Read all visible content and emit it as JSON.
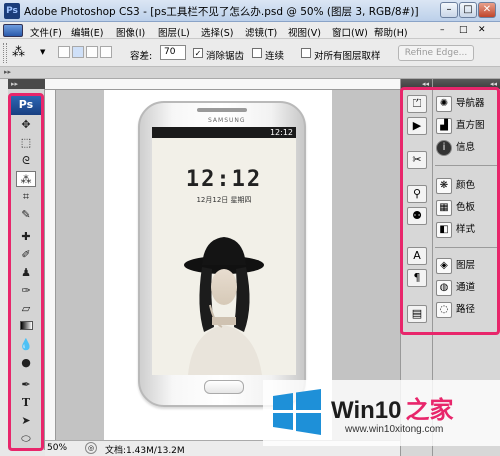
{
  "window": {
    "title": "Adobe Photoshop CS3 - [ps工具栏不见了怎么办.psd @ 50% (图层 3, RGB/8#)]",
    "buttons": [
      "–",
      "□",
      "✕"
    ]
  },
  "menubar": {
    "items": [
      "文件(F)",
      "编辑(E)",
      "图像(I)",
      "图层(L)",
      "选择(S)",
      "滤镜(T)",
      "视图(V)",
      "窗口(W)",
      "帮助(H)"
    ],
    "mdi_buttons": [
      "–",
      "□",
      "✕"
    ]
  },
  "options_bar": {
    "tolerance_label": "容差:",
    "tolerance_value": "70",
    "antialias_label": "消除锯齿",
    "antialias_checked": true,
    "contiguous_label": "连续",
    "contiguous_checked": false,
    "all_layers_label": "对所有图层取样",
    "all_layers_checked": false,
    "refine_edge": "Refine Edge..."
  },
  "toolbox": {
    "logo": "Ps",
    "tools": [
      "move-tool",
      "marquee-tool",
      "lasso-tool",
      "magic-wand-tool",
      "crop-tool",
      "eyedropper-tool",
      "healing-tool",
      "brush-tool",
      "clone-stamp-tool",
      "history-brush-tool",
      "eraser-tool",
      "gradient-tool",
      "blur-tool",
      "dodge-tool",
      "pen-tool",
      "type-tool",
      "path-select-tool",
      "shape-tool"
    ],
    "selected": "magic-wand-tool",
    "type_glyph": "T"
  },
  "document": {
    "phone": {
      "brand": "SAMSUNG",
      "status_time": "12:12",
      "clock": "12:12",
      "date": "12月12日  星期四"
    }
  },
  "statusbar": {
    "zoom": "50%",
    "doc_info": "文档:1.43M/13.2M"
  },
  "panels": {
    "collapse_glyph": "◂◂",
    "groups": [
      [
        {
          "icon": "navigator-icon",
          "label": "导航器"
        },
        {
          "icon": "histogram-icon",
          "label": "直方图"
        },
        {
          "icon": "info-icon",
          "label": "信息"
        }
      ],
      [
        {
          "icon": "color-icon",
          "label": "颜色"
        },
        {
          "icon": "swatches-icon",
          "label": "色板"
        },
        {
          "icon": "styles-icon",
          "label": "样式"
        }
      ],
      [
        {
          "icon": "layers-icon",
          "label": "图层"
        },
        {
          "icon": "channels-icon",
          "label": "通道"
        },
        {
          "icon": "paths-icon",
          "label": "路径"
        }
      ]
    ]
  },
  "watermark": {
    "brand_a": "Win10",
    "brand_b": "之家",
    "url": "www.win10xitong.com"
  },
  "colors": {
    "highlight": "#e8266b",
    "title_bar": "#c9d8ec",
    "win_logo": "#1e90d8"
  }
}
